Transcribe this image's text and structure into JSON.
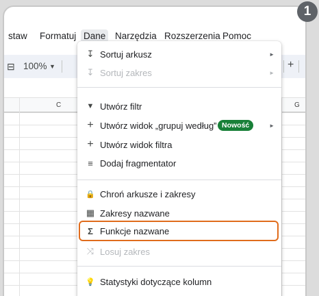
{
  "menubar": {
    "items": [
      "staw",
      "Formatuj",
      "Dane",
      "Narzędzia",
      "Rozszerzenia",
      "Pomoc"
    ],
    "active_index": 2
  },
  "toolbar": {
    "zoom": "100%",
    "plus": "+"
  },
  "columns": {
    "c": "C",
    "g": "G"
  },
  "step_number": "1",
  "menu": {
    "items": [
      {
        "icon": "sort-icon",
        "glyph": "↧",
        "label": "Sortuj arkusz",
        "submenu": true,
        "disabled": false
      },
      {
        "icon": "sort-icon",
        "glyph": "↧",
        "label": "Sortuj zakres",
        "submenu": true,
        "disabled": true
      },
      {
        "icon": "filter-icon",
        "glyph": "▼",
        "label": "Utwórz filtr",
        "submenu": false,
        "disabled": false
      },
      {
        "icon": "plus-icon",
        "glyph": "+",
        "label": "Utwórz widok „grupuj według”",
        "submenu": true,
        "disabled": false,
        "badge": "Nowość"
      },
      {
        "icon": "plus-icon",
        "glyph": "+",
        "label": "Utwórz widok filtra",
        "submenu": false,
        "disabled": false
      },
      {
        "icon": "slicer-icon",
        "glyph": "≡",
        "label": "Dodaj fragmentator",
        "submenu": false,
        "disabled": false
      },
      {
        "icon": "lock-icon",
        "glyph": "🔒",
        "label": "Chroń arkusze i zakresy",
        "submenu": false,
        "disabled": false
      },
      {
        "icon": "table-icon",
        "glyph": "▦",
        "label": "Zakresy nazwane",
        "submenu": false,
        "disabled": false
      },
      {
        "icon": "sigma-icon",
        "glyph": "Σ",
        "label": "Funkcje nazwane",
        "submenu": false,
        "disabled": false,
        "highlighted": true
      },
      {
        "icon": "shuffle-icon",
        "glyph": "⤨",
        "label": "Losuj zakres",
        "submenu": false,
        "disabled": true
      },
      {
        "icon": "bulb-icon",
        "glyph": "💡",
        "label": "Statystyki dotyczące kolumn",
        "submenu": false,
        "disabled": false
      }
    ]
  },
  "colors": {
    "highlight": "#e06c1c",
    "badge": "#188038"
  }
}
